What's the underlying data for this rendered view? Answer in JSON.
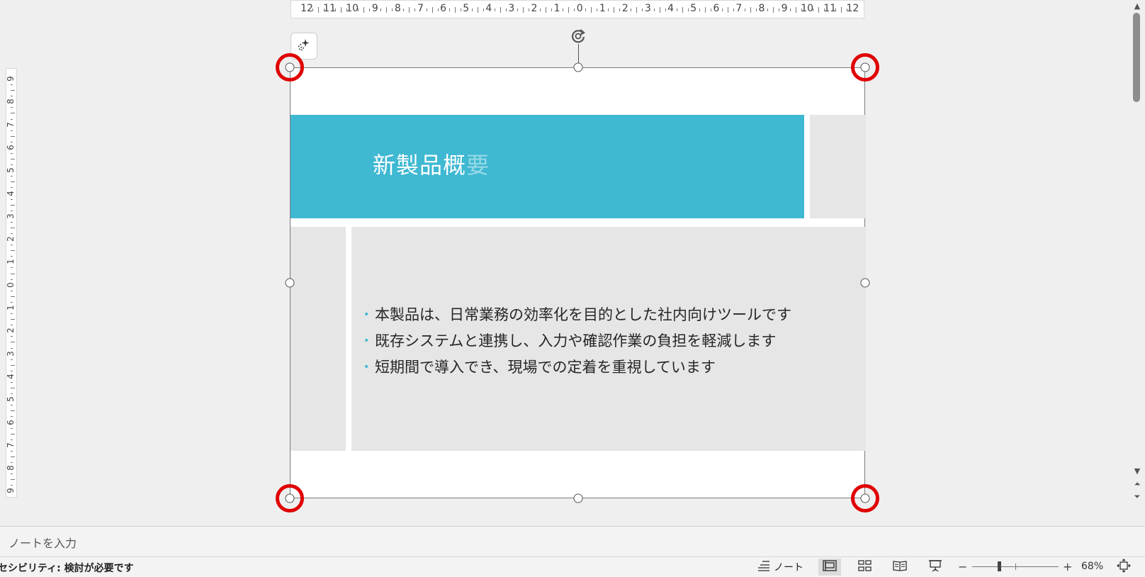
{
  "ruler": {
    "horizontal_labels": [
      "12",
      "11",
      "10",
      "9",
      "8",
      "7",
      "6",
      "5",
      "4",
      "3",
      "2",
      "1",
      "0",
      "1",
      "2",
      "3",
      "4",
      "5",
      "6",
      "7",
      "8",
      "9",
      "10",
      "11",
      "12"
    ],
    "vertical_labels": [
      "9",
      "8",
      "7",
      "6",
      "5",
      "4",
      "3",
      "2",
      "1",
      "0",
      "1",
      "2",
      "3",
      "4",
      "5",
      "6",
      "7",
      "8",
      "9"
    ]
  },
  "slide": {
    "title_main": "新製品概",
    "title_faded": "要",
    "bullets": [
      "本製品は、日常業務の効率化を目的とした社内向けツールです",
      "既存システムと連携し、入力や確認作業の負担を軽減します",
      "短期間で導入でき、現場での定着を重視しています"
    ],
    "bullet_marker": "•",
    "accent_color": "#3fb8d2"
  },
  "toolbar": {
    "designer_icon": "sparkle-icon",
    "rotate_icon": "rotate-icon"
  },
  "notes": {
    "placeholder": "ノートを入力"
  },
  "statusbar": {
    "accessibility": "セシビリティ: 検討が必要です",
    "notes_label": "ノート",
    "zoom_minus": "−",
    "zoom_plus": "+",
    "zoom_value": "68%"
  },
  "colors": {
    "highlight_ring": "#e00000",
    "title_bar": "#3fb8d2",
    "panel_gray": "#e6e6e6"
  }
}
